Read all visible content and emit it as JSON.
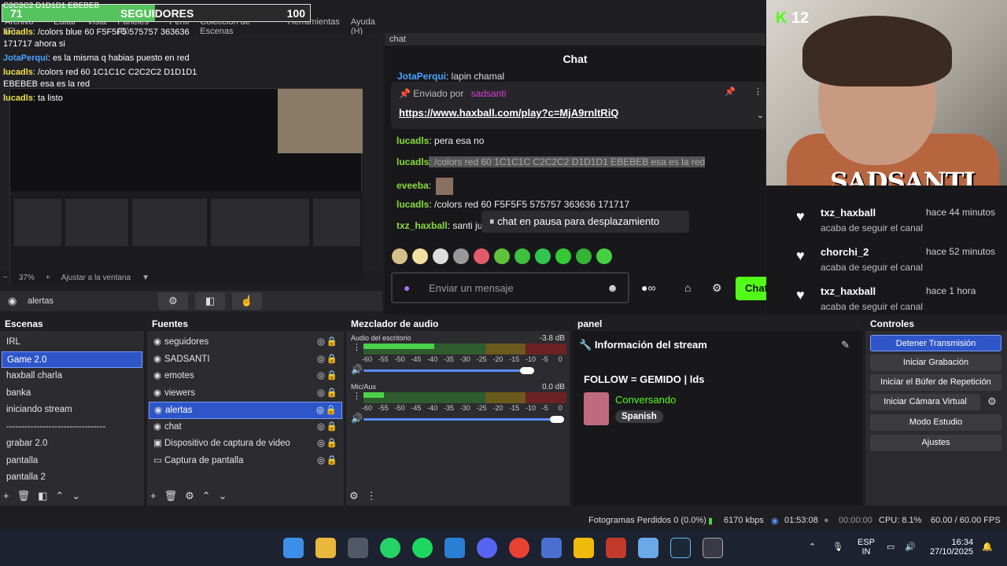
{
  "menu": [
    "Archivo (F)",
    "Editar",
    "Vista",
    "Paneles (D)",
    "Perfil",
    "Colección de Escenas",
    "Herramientas",
    "Ayuda (H)"
  ],
  "followers": {
    "current": "71",
    "label": "SEGUIDORES",
    "goal": "100",
    "progress": 0.71
  },
  "overlay_chat": {
    "header_text": "C2C2C2 D1D1D1 EBEBEB",
    "lines": [
      {
        "user": "lucadls",
        "text": ": /colors blue 60 F5F5F5 575757 363636 171717 ahora si"
      },
      {
        "user": "JotaPerquí",
        "text": ": es la misma q habias puesto en red"
      },
      {
        "user": "lucadls",
        "text": ": /colors red 60 1C1C1C C2C2C2 D1D1D1 EBEBEB esa es la red"
      },
      {
        "user": "lucadls",
        "text": ": ta listo"
      }
    ]
  },
  "preview": {
    "zoom": "37%",
    "fit_label": "Ajustar a la ventana"
  },
  "source_toolbar": {
    "label": "alertas"
  },
  "chat": {
    "dock_title": "chat",
    "title": "Chat",
    "top_line": {
      "user": "JotaPerqui",
      "text": ": lapin chamal"
    },
    "pinned": {
      "sent_by": "Enviado por",
      "user": "sadsanti",
      "link": "https://www.haxball.com/play?c=MjA9rnltRiQ"
    },
    "messages": [
      {
        "user": "lucadls",
        "text": ": pera esa no"
      },
      {
        "user": "lucadls",
        "text": ": /colors red 60 1C1C1C C2C2C2 D1D1D1 EBEBEB esa es la red"
      },
      {
        "user": "eveeba",
        "text": ":"
      },
      {
        "user": "lucadls",
        "text": ": /colors red 60 F5F5F5 575757 363636 171717"
      },
      {
        "user": "txz_haxball",
        "text": ": santi ju"
      }
    ],
    "pause_text": "chat en pausa para desplazamiento",
    "input_placeholder": "Enviar un mensaje",
    "send_label": "Chat",
    "send_color": "#53fc18"
  },
  "cam": {
    "name": "SADSANTI",
    "badge_count": "12"
  },
  "follows": [
    {
      "user": "txz_haxball",
      "time": "hace 44 minutos",
      "sub": "acaba de seguir el canal"
    },
    {
      "user": "chorchi_2",
      "time": "hace 52 minutos",
      "sub": "acaba de seguir el canal"
    },
    {
      "user": "txz_haxball",
      "time": "hace 1 hora",
      "sub": "acaba de seguir el canal"
    }
  ],
  "scenes": {
    "title": "Escenas",
    "items": [
      "IRL",
      "Game 2.0",
      "haxball charla",
      "banka",
      "iniciando stream",
      "---------------------------------",
      "grabar 2.0",
      "pantalla",
      "pantalla 2"
    ],
    "selected": 1
  },
  "sources": {
    "title": "Fuentes",
    "items": [
      {
        "icon": "browser-icon",
        "label": "seguidores"
      },
      {
        "icon": "browser-icon",
        "label": "SADSANTI"
      },
      {
        "icon": "browser-icon",
        "label": "emotes"
      },
      {
        "icon": "browser-icon",
        "label": "viewers"
      },
      {
        "icon": "browser-icon",
        "label": "alertas"
      },
      {
        "icon": "browser-icon",
        "label": "chat"
      },
      {
        "icon": "camera-icon",
        "label": "Dispositivo de captura de video"
      },
      {
        "icon": "monitor-icon",
        "label": "Captura de pantalla"
      }
    ],
    "selected": 4
  },
  "mixer": {
    "title": "Mezclador de audio",
    "channels": [
      {
        "name": "Audio del escritorio",
        "db": "-3.8 dB",
        "level": 0.35,
        "volume": 0.85
      },
      {
        "name": "Mic/Aux",
        "db": "0.0 dB",
        "level": 0.1,
        "volume": 1.0
      }
    ],
    "scale": [
      "-60",
      "-55",
      "-50",
      "-45",
      "-40",
      "-35",
      "-30",
      "-25",
      "-20",
      "-15",
      "-10",
      "-5",
      "0"
    ]
  },
  "panel": {
    "title": "panel",
    "heading": "Información del stream",
    "stream_title": "FOLLOW = GEMIDO | lds",
    "category": "Conversando",
    "language": "Spanish",
    "category_color": "#53fc18"
  },
  "controls": {
    "title": "Controles",
    "buttons": [
      "Detener Transmisión",
      "Iniciar Grabación",
      "Iniciar el Búfer de Repetición",
      "Iniciar Cámara Virtual",
      "Modo Estudio",
      "Ajustes"
    ]
  },
  "status": {
    "dropped": "Fotogramas Perdidos 0 (0.0%)",
    "bitrate": "6170 kbps",
    "live_time": "01:53:08",
    "rec_time": "00:00:00",
    "cpu": "CPU: 8.1%",
    "fps": "60.00 / 60.00 FPS"
  },
  "taskbar": {
    "lang": "ESP",
    "lang2": "IN",
    "time": "16:34",
    "date": "27/10/2025"
  }
}
